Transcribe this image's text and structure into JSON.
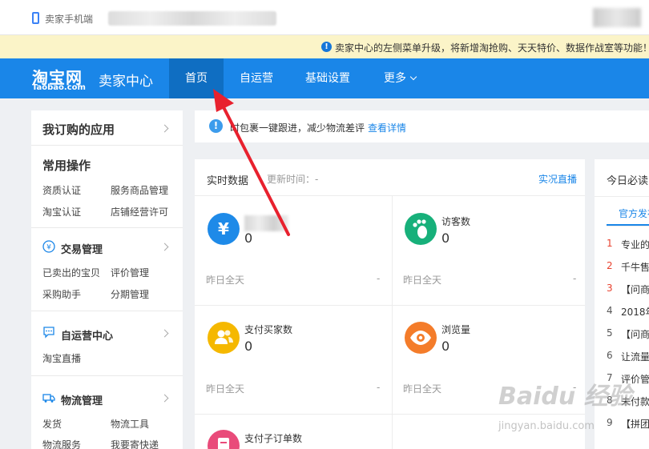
{
  "browser": {
    "mobile_label": "卖家手机端"
  },
  "notice": {
    "text": "卖家中心的左侧菜单升级，将新增淘抢购、天天特价、数据作战室等功能！"
  },
  "nav": {
    "logo_main": "淘宝网",
    "logo_sub": "Taobao.com",
    "center_title": "卖家中心",
    "tabs": [
      {
        "label": "首页"
      },
      {
        "label": "自运营"
      },
      {
        "label": "基础设置"
      },
      {
        "label": "更多"
      }
    ]
  },
  "sidebar": {
    "head": "我订购的应用",
    "common": {
      "title": "常用操作",
      "links": [
        "资质认证",
        "服务商品管理",
        "淘宝认证",
        "店铺经营许可"
      ]
    },
    "trade": {
      "title": "交易管理",
      "links": [
        "已卖出的宝贝",
        "评价管理",
        "采购助手",
        "分期管理"
      ]
    },
    "self": {
      "title": "自运营中心",
      "links": [
        "淘宝直播"
      ]
    },
    "logistics": {
      "title": "物流管理",
      "links": [
        "发货",
        "物流工具",
        "物流服务",
        "我要寄快递"
      ]
    }
  },
  "announce": {
    "text": "时包裹一键跟进，减少物流差评",
    "link": "查看详情"
  },
  "realtime": {
    "title": "实时数据",
    "update_label": "更新时间：-",
    "live_link": "实况直播",
    "metrics": [
      {
        "label": "",
        "value": "0",
        "foot": "昨日全天",
        "dash": "-",
        "icon": "yen-icon",
        "color": "#1e8ae8"
      },
      {
        "label": "访客数",
        "value": "0",
        "foot": "昨日全天",
        "dash": "-",
        "icon": "footprint-icon",
        "color": "#17b07a"
      },
      {
        "label": "支付买家数",
        "value": "0",
        "foot": "昨日全天",
        "dash": "-",
        "icon": "users-icon",
        "color": "#f5b800"
      },
      {
        "label": "浏览量",
        "value": "0",
        "foot": "昨日全天",
        "dash": "-",
        "icon": "eye-icon",
        "color": "#f47c2a"
      },
      {
        "label": "支付子订单数",
        "value": "",
        "foot": "",
        "dash": "",
        "icon": "order-icon",
        "color": "#e94b7a"
      }
    ]
  },
  "must_read": {
    "title": "今日必读",
    "tab": "官方发布",
    "items": [
      {
        "n": "1",
        "text": "专业的"
      },
      {
        "n": "2",
        "text": "千牛售"
      },
      {
        "n": "3",
        "text": "【问商"
      },
      {
        "n": "4",
        "text": "2018年"
      },
      {
        "n": "5",
        "text": "【问商"
      },
      {
        "n": "6",
        "text": "让流量"
      },
      {
        "n": "7",
        "text": "评价管"
      },
      {
        "n": "8",
        "text": "未付款"
      },
      {
        "n": "9",
        "text": "【拼团"
      }
    ]
  },
  "watermark": {
    "brand": "Baidu 经验",
    "url": "jingyan.baidu.com"
  },
  "colors": {
    "nav_blue": "#1a86e8",
    "nav_active": "#0f6ec2",
    "arrow_red": "#e8212e"
  }
}
